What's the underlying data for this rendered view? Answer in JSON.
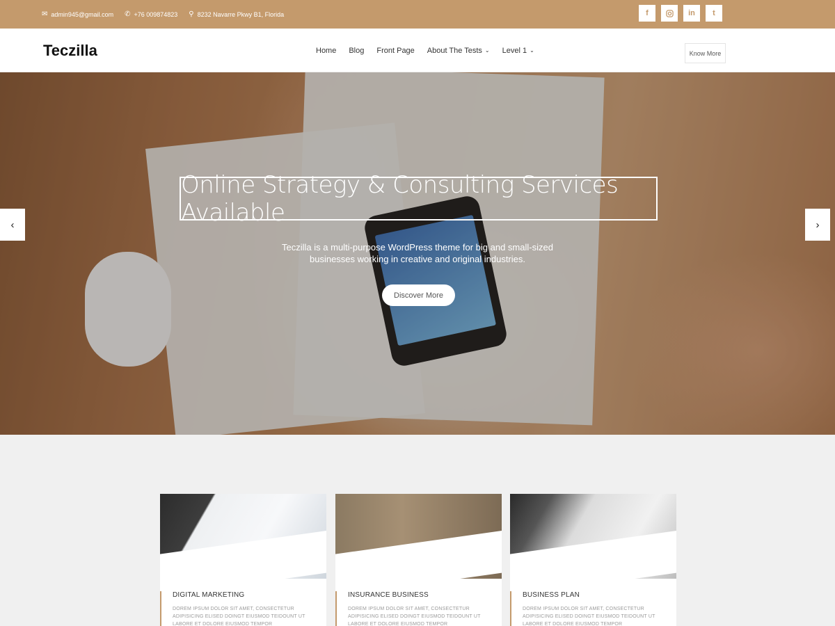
{
  "topbar": {
    "email": "admin945@gmail.com",
    "phone": "+76 009874823",
    "address": "8232 Navarre Pkwy B1, Florida",
    "social": [
      "f",
      "ig",
      "in",
      "t"
    ]
  },
  "header": {
    "logo": "Teczilla",
    "nav": [
      {
        "label": "Home"
      },
      {
        "label": "Blog"
      },
      {
        "label": "Front Page"
      },
      {
        "label": "About The Tests"
      },
      {
        "label": "Level 1"
      }
    ],
    "cta": "Know More"
  },
  "hero": {
    "title": "Online Strategy & Consulting Services Available",
    "subtitle": "Teczilla is a multi-purpose WordPress theme for big and small-sized businesses working in creative and original industries.",
    "button": "Discover More"
  },
  "services": [
    {
      "title": "DIGITAL MARKETING",
      "desc": "DOREM IPSUM DOLOR SIT AMET, CONSECTETUR ADIPISICING ELISED DOINGT EIUSMOD TEIDOUNT UT LABORE ET DOLORE EIUSMOD TEMPOR"
    },
    {
      "title": "INSURANCE BUSINESS",
      "desc": "DOREM IPSUM DOLOR SIT AMET, CONSECTETUR ADIPISICING ELISED DOINGT EIUSMOD TEIDOUNT UT LABORE ET DOLORE EIUSMOD TEMPOR"
    },
    {
      "title": "BUSINESS PLAN",
      "desc": "DOREM IPSUM DOLOR SIT AMET, CONSECTETUR ADIPISICING ELISED DOINGT EIUSMOD TEIDOUNT UT LABORE ET DOLORE EIUSMOD TEMPOR"
    }
  ],
  "colors": {
    "accent": "#c49a6c"
  }
}
